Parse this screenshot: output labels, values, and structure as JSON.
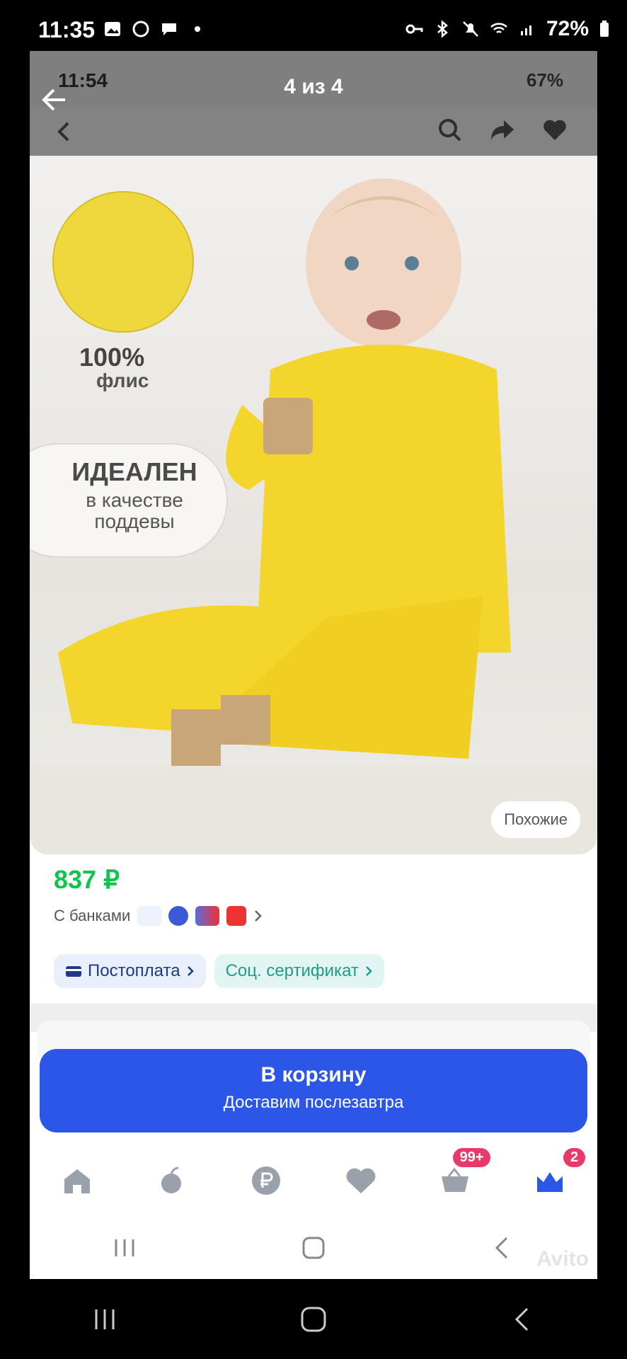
{
  "outer_status": {
    "time": "11:35",
    "battery": "72%"
  },
  "viewer": {
    "counter": "4 из 4"
  },
  "inner_status": {
    "time": "11:54",
    "battery": "67%"
  },
  "product_image": {
    "material_percent": "100%",
    "material_name": "флис",
    "ideal_title": "ИДЕАЛЕН",
    "ideal_sub_1": "в качестве",
    "ideal_sub_2": "поддевы",
    "similar_label": "Похожие"
  },
  "price": {
    "value": "837 ₽",
    "banks_label": "С банками"
  },
  "chips": {
    "postpay": "Постоплата",
    "social": "Соц. сертификат"
  },
  "cart_button": {
    "title": "В корзину",
    "subtitle": "Доставим послезавтра"
  },
  "tabbar": {
    "cart_badge": "99+",
    "profile_badge": "2",
    "icons": [
      "home-icon",
      "fresh-icon",
      "ruble-icon",
      "favorites-icon",
      "cart-icon",
      "profile-icon"
    ]
  },
  "watermark": "Avito",
  "colors": {
    "accent": "#2b56e8",
    "price": "#10c44c",
    "badge": "#e83a6a",
    "suit": "#f3d52b"
  }
}
